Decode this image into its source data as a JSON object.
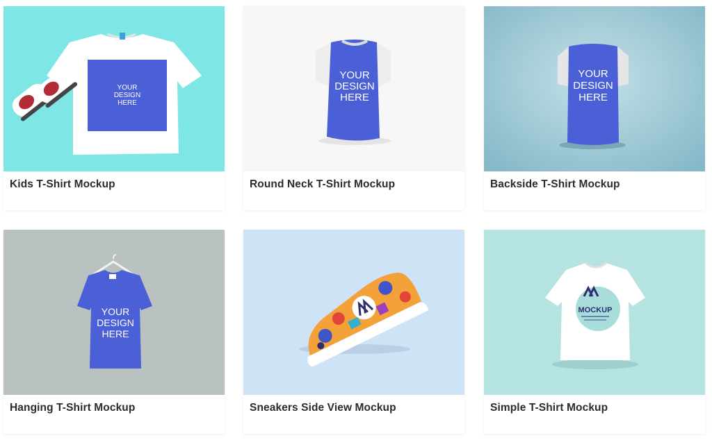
{
  "cards": [
    {
      "title": "Kids T-Shirt Mockup",
      "placeholder": [
        "YOUR",
        "DESIGN",
        "HERE"
      ]
    },
    {
      "title": "Round Neck T-Shirt Mockup",
      "placeholder": [
        "YOUR",
        "DESIGN",
        "HERE"
      ]
    },
    {
      "title": "Backside T-Shirt Mockup",
      "placeholder": [
        "YOUR",
        "DESIGN",
        "HERE"
      ]
    },
    {
      "title": "Hanging T-Shirt Mockup",
      "placeholder": [
        "YOUR",
        "DESIGN",
        "HERE"
      ]
    },
    {
      "title": "Sneakers Side View Mockup",
      "placeholder": []
    },
    {
      "title": "Simple T-Shirt Mockup",
      "logo_text": "MOCKUP"
    }
  ],
  "colors": {
    "shirt_blue": "#4b5fd6",
    "kids_bg": "#7fe6e6",
    "backside_bg": "#9fc9d6",
    "hanging_bg": "#b9c1c1",
    "sneaker_bg": "#cfe3f6",
    "simple_bg": "#b5e3e1"
  }
}
